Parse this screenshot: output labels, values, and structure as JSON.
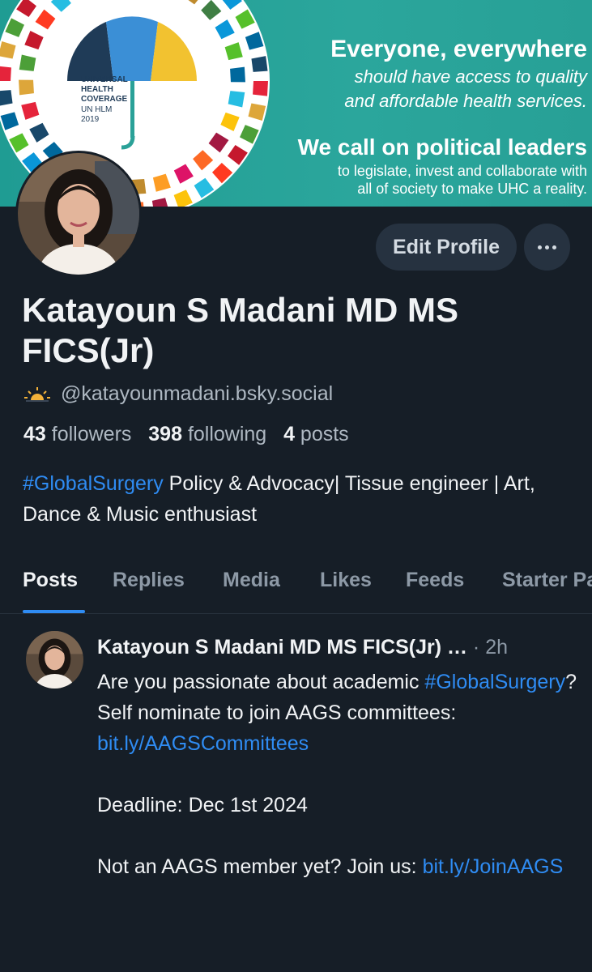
{
  "banner": {
    "logo_line1": "UNIVERSAL",
    "logo_line2": "HEALTH",
    "logo_line3": "COVERAGE",
    "logo_line4": "UN HLM",
    "logo_line5": "2019",
    "headline": "Everyone, everywhere",
    "line2": "should have access to quality",
    "line3": "and affordable health services.",
    "headline2": "We call on political leaders",
    "line5": "to legislate, invest and collaborate with",
    "line6": "all of society to make UHC a reality."
  },
  "profile": {
    "display_name": "Katayoun S Madani MD MS FICS(Jr)",
    "handle_icon": "sunrise-icon",
    "handle": "@katayounmadani.bsky.social",
    "followers_count": "43",
    "followers_label": "followers",
    "following_count": "398",
    "following_label": "following",
    "posts_count": "4",
    "posts_label": "posts",
    "bio_hashtag": "#GlobalSurgery",
    "bio_rest": " Policy & Advocacy| Tissue engineer | Art, Dance & Music enthusiast"
  },
  "actions": {
    "edit_profile": "Edit Profile",
    "more_icon": "ellipsis-icon"
  },
  "tabs": [
    "Posts",
    "Replies",
    "Media",
    "Likes",
    "Feeds",
    "Starter Packs"
  ],
  "active_tab": "Posts",
  "post": {
    "author": "Katayoun S Madani MD MS FICS(Jr) …",
    "time": " · 2h",
    "text_1": "Are you passionate about academic ",
    "hashtag": "#GlobalSurgery",
    "text_2": "? Self nominate to join AAGS committees: ",
    "link_1": "bit.ly/AAGSCommittees",
    "text_3": "\n\nDeadline: Dec 1st 2024\n\nNot an AAGS member yet? Join us: ",
    "link_2": "bit.ly/JoinAAGS"
  },
  "colors": {
    "background": "#161e27",
    "accent_link": "#2f8cf3",
    "muted_text": "#8d99a6",
    "banner_teal": "#2aa198"
  }
}
